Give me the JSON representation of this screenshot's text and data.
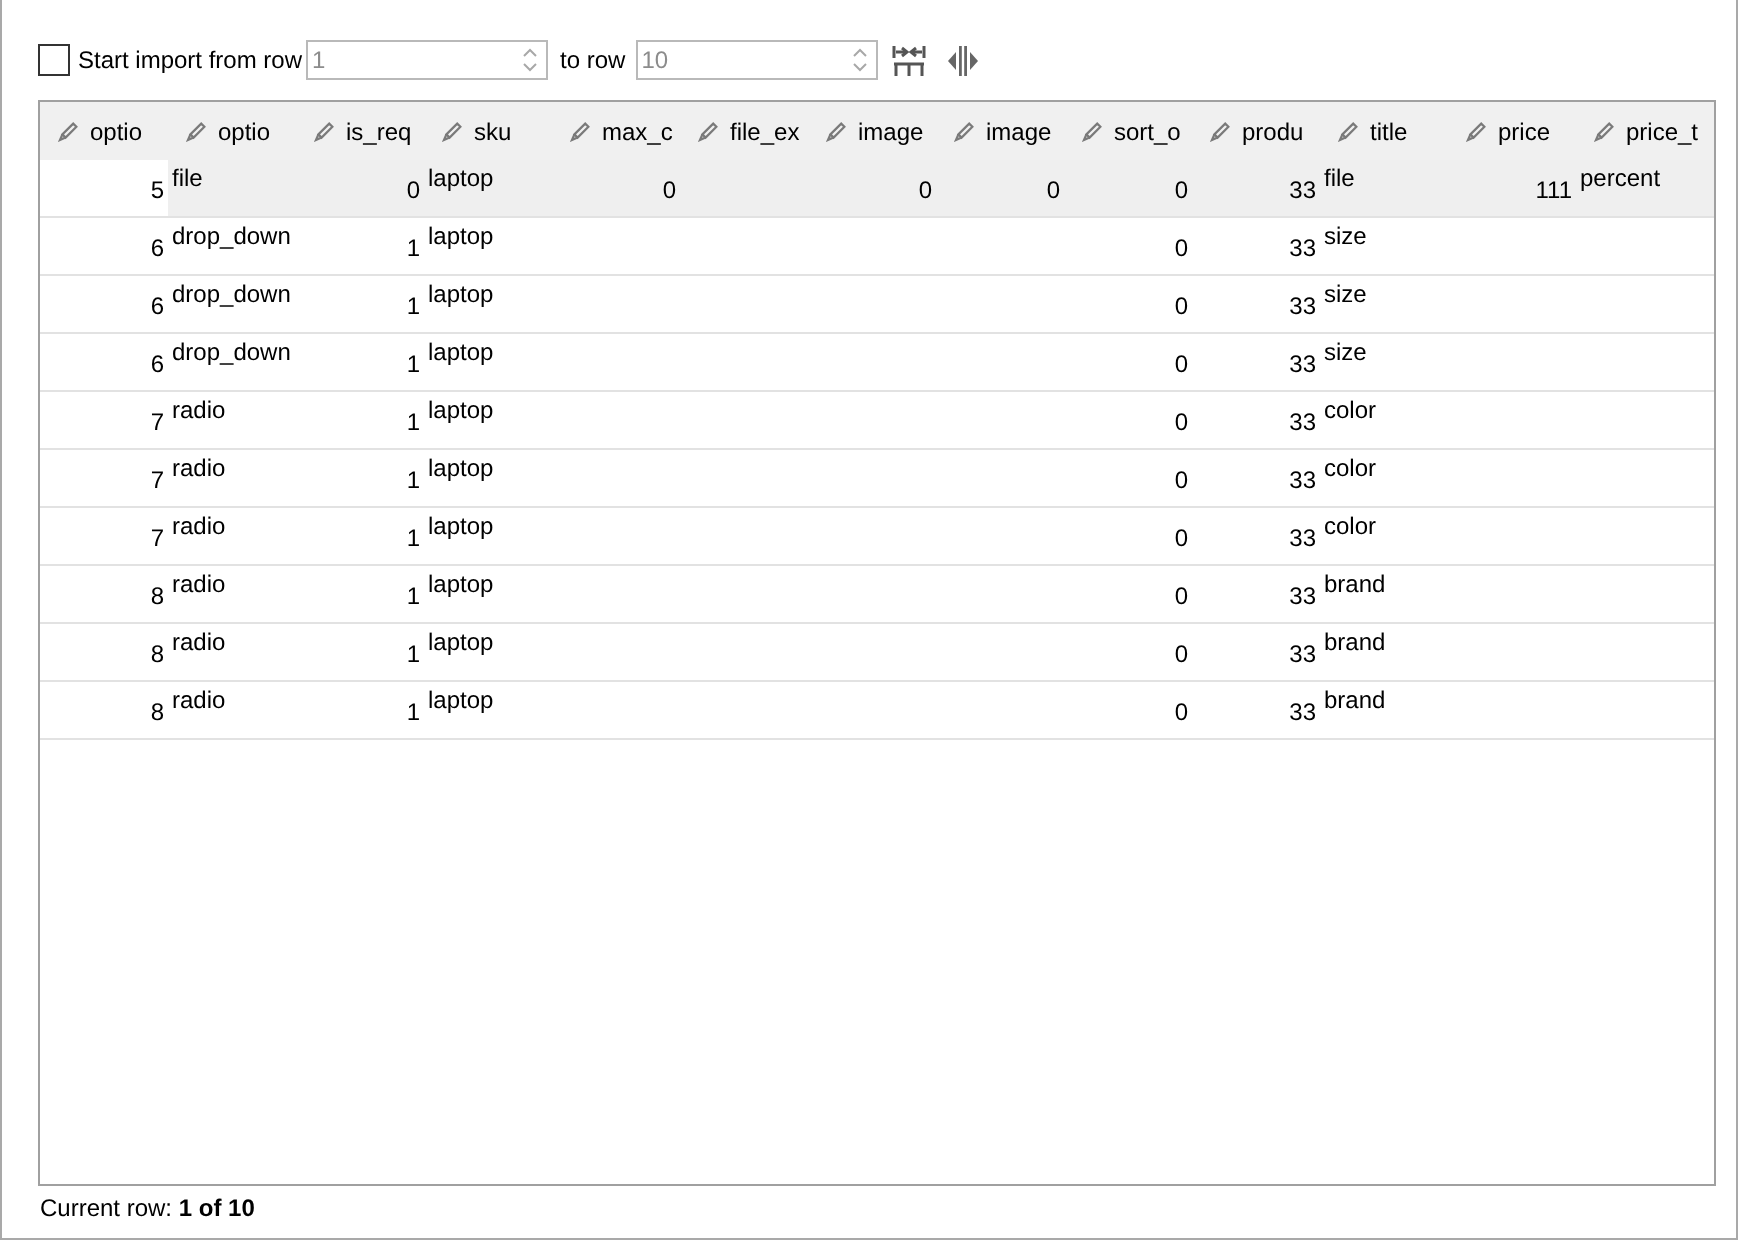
{
  "import_options": {
    "start_row": {
      "label": "Start import from row",
      "checked": false
    },
    "from_field": {
      "value": "1",
      "disabled": true
    },
    "to_label": "to row",
    "to_field": {
      "value": "10",
      "disabled": true
    }
  },
  "table": {
    "columns": [
      {
        "header": "optio",
        "kind": "number"
      },
      {
        "header": "optio",
        "kind": "text"
      },
      {
        "header": "is_req",
        "kind": "number"
      },
      {
        "header": "sku",
        "kind": "text"
      },
      {
        "header": "max_c",
        "kind": "number"
      },
      {
        "header": "file_ex",
        "kind": "text"
      },
      {
        "header": "image",
        "kind": "number"
      },
      {
        "header": "image",
        "kind": "number"
      },
      {
        "header": "sort_o",
        "kind": "number"
      },
      {
        "header": "produ",
        "kind": "number"
      },
      {
        "header": "title",
        "kind": "text"
      },
      {
        "header": "price",
        "kind": "number"
      },
      {
        "header": "price_t",
        "kind": "text"
      }
    ],
    "rows": [
      {
        "selected": true,
        "cells": [
          "5",
          "file",
          "0",
          "laptop",
          "0",
          null,
          "0",
          "0",
          "0",
          "33",
          "file",
          "111",
          "percent"
        ]
      },
      {
        "selected": false,
        "cells": [
          "6",
          "drop_down",
          "1",
          "laptop",
          null,
          null,
          null,
          null,
          "0",
          "33",
          "size",
          null,
          null
        ]
      },
      {
        "selected": false,
        "cells": [
          "6",
          "drop_down",
          "1",
          "laptop",
          null,
          null,
          null,
          null,
          "0",
          "33",
          "size",
          null,
          null
        ]
      },
      {
        "selected": false,
        "cells": [
          "6",
          "drop_down",
          "1",
          "laptop",
          null,
          null,
          null,
          null,
          "0",
          "33",
          "size",
          null,
          null
        ]
      },
      {
        "selected": false,
        "cells": [
          "7",
          "radio",
          "1",
          "laptop",
          null,
          null,
          null,
          null,
          "0",
          "33",
          "color",
          null,
          null
        ]
      },
      {
        "selected": false,
        "cells": [
          "7",
          "radio",
          "1",
          "laptop",
          null,
          null,
          null,
          null,
          "0",
          "33",
          "color",
          null,
          null
        ]
      },
      {
        "selected": false,
        "cells": [
          "7",
          "radio",
          "1",
          "laptop",
          null,
          null,
          null,
          null,
          "0",
          "33",
          "color",
          null,
          null
        ]
      },
      {
        "selected": false,
        "cells": [
          "8",
          "radio",
          "1",
          "laptop",
          null,
          null,
          null,
          null,
          "0",
          "33",
          "brand",
          null,
          null
        ]
      },
      {
        "selected": false,
        "cells": [
          "8",
          "radio",
          "1",
          "laptop",
          null,
          null,
          null,
          null,
          "0",
          "33",
          "brand",
          null,
          null
        ]
      },
      {
        "selected": false,
        "cells": [
          "8",
          "radio",
          "1",
          "laptop",
          null,
          null,
          null,
          null,
          "0",
          "33",
          "brand",
          null,
          null
        ]
      }
    ]
  },
  "status_bar": {
    "text": "Current row: **1 of 10**"
  }
}
